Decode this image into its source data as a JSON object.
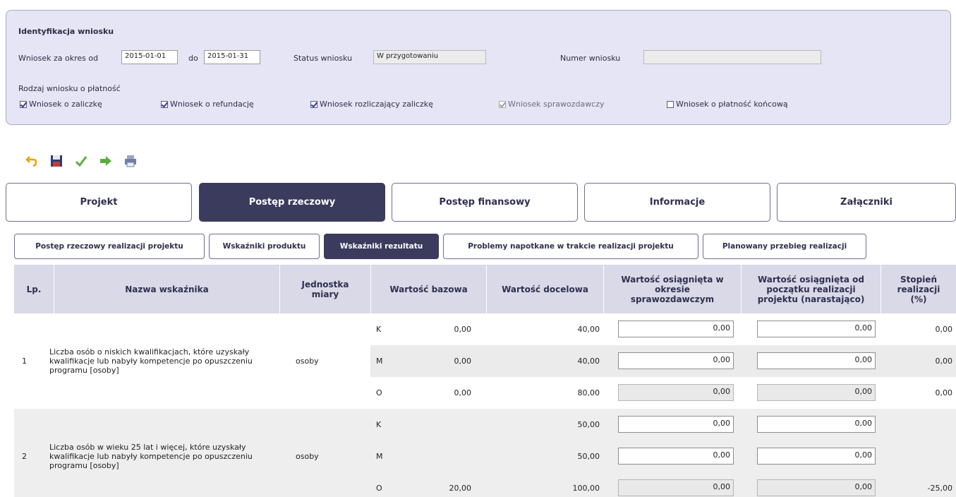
{
  "identification": {
    "title": "Identyfikacja wniosku",
    "period_from_label": "Wniosek za okres od",
    "period_from": "2015-01-01",
    "period_to_label": "do",
    "period_to": "2015-01-31",
    "status_label": "Status wniosku",
    "status_value": "W przygotowaniu",
    "number_label": "Numer wniosku",
    "number_value": "",
    "type_label": "Rodzaj wniosku o płatność",
    "types": [
      {
        "label": "Wniosek o zaliczkę",
        "checked": true,
        "disabled": false
      },
      {
        "label": "Wniosek o refundację",
        "checked": true,
        "disabled": false
      },
      {
        "label": "Wniosek rozliczający zaliczkę",
        "checked": true,
        "disabled": false
      },
      {
        "label": "Wniosek sprawozdawczy",
        "checked": true,
        "disabled": true
      },
      {
        "label": "Wniosek o płatność końcową",
        "checked": false,
        "disabled": false
      }
    ]
  },
  "toolbar": {
    "icons": [
      "undo-icon",
      "save-icon",
      "validate-icon",
      "submit-icon",
      "print-icon"
    ]
  },
  "main_tabs": [
    {
      "label": "Projekt",
      "active": false
    },
    {
      "label": "Postęp rzeczowy",
      "active": true
    },
    {
      "label": "Postęp finansowy",
      "active": false
    },
    {
      "label": "Informacje",
      "active": false
    },
    {
      "label": "Załączniki",
      "active": false
    }
  ],
  "sub_tabs": [
    {
      "label": "Postęp rzeczowy realizacji projektu",
      "active": false
    },
    {
      "label": "Wskaźniki produktu",
      "active": false
    },
    {
      "label": "Wskaźniki rezultatu",
      "active": true
    },
    {
      "label": "Problemy napotkane w trakcie realizacji projektu",
      "active": false
    },
    {
      "label": "Planowany przebieg realizacji",
      "active": false
    }
  ],
  "table": {
    "headers": {
      "lp": "Lp.",
      "name": "Nazwa wskaźnika",
      "unit": "Jednostka miary",
      "base": "Wartość bazowa",
      "target": "Wartość docelowa",
      "period": "Wartość osiągnięta w okresie sprawozdawczym",
      "cumulative": "Wartość osiągnięta od początku realizacji projektu (narastająco)",
      "degree": "Stopień realizacji (%)"
    },
    "indicators": [
      {
        "lp": "1",
        "name": "Liczba osób o niskich kwalifikacjach, które uzyskały kwalifikacje lub nabyły kompetencje po opuszczeniu programu [osoby]",
        "unit": "osoby",
        "rows": [
          {
            "gender": "K",
            "base": "0,00",
            "target": "40,00",
            "period": "0,00",
            "cumulative": "0,00",
            "degree": "0,00"
          },
          {
            "gender": "M",
            "base": "0,00",
            "target": "40,00",
            "period": "0,00",
            "cumulative": "0,00",
            "degree": "0,00"
          },
          {
            "gender": "O",
            "base": "0,00",
            "target": "80,00",
            "period": "0,00",
            "cumulative": "0,00",
            "degree": "0,00"
          }
        ]
      },
      {
        "lp": "2",
        "name": "Liczba osób w wieku 25 lat i więcej, które uzyskały kwalifikacje lub nabyły kompetencje po opuszczeniu programu [osoby]",
        "unit": "osoby",
        "rows": [
          {
            "gender": "K",
            "base": "",
            "target": "50,00",
            "period": "0,00",
            "cumulative": "0,00",
            "degree": ""
          },
          {
            "gender": "M",
            "base": "",
            "target": "50,00",
            "period": "0,00",
            "cumulative": "0,00",
            "degree": ""
          },
          {
            "gender": "O",
            "base": "20,00",
            "target": "100,00",
            "period": "0,00",
            "cumulative": "0,00",
            "degree": "-25,00"
          }
        ]
      }
    ]
  },
  "colors": {
    "panel_bg": "#e6e5f5",
    "active_tab": "#3b3b5e",
    "header_bg": "#d9d9e8",
    "band_bg": "#eeeeee"
  }
}
